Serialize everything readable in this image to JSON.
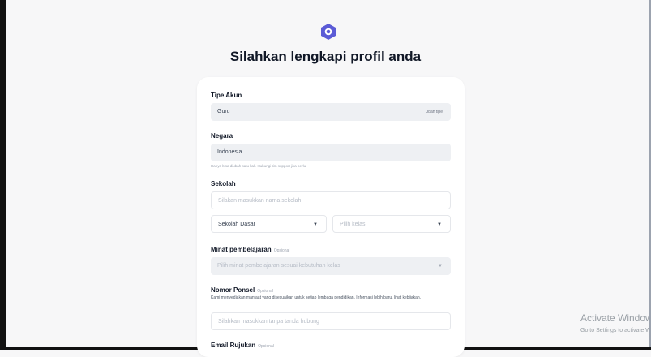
{
  "header": {
    "title": "Silahkan lengkapi profil anda",
    "logo_icon": "hexagon-logo-icon",
    "accent": "#5b5bd6"
  },
  "form": {
    "tipe_akun": {
      "label": "Tipe Akun",
      "value": "Guru",
      "action": "Ubah tipe"
    },
    "negara": {
      "label": "Negara",
      "value": "Indonesia",
      "hint": "Hanya bisa diubah satu kali. Hubungi tim support jika perlu."
    },
    "sekolah": {
      "label": "Sekolah",
      "placeholder": "Silakan masukkan nama sekolah",
      "level_value": "Sekolah Dasar",
      "class_placeholder": "Pilih kelas"
    },
    "minat": {
      "label": "Minat pembelajaran",
      "optional": "Opsional",
      "placeholder": "Pilih minat pembelajaran sesuai kebutuhan kelas"
    },
    "ponsel": {
      "label": "Nomor Ponsel",
      "optional": "Opsional",
      "description": "Kami menyediakan manfaat yang disesuaikan untuk setiap lembaga pendidikan. Informasi lebih baru, lihat kebijakan.",
      "placeholder": "Silahkan masukkan tanpa tanda hubung"
    },
    "email": {
      "label": "Email Rujukan",
      "optional": "Opsional"
    }
  },
  "watermark": {
    "line1": "Activate Windows",
    "line2": "Go to Settings to activate Windows."
  }
}
